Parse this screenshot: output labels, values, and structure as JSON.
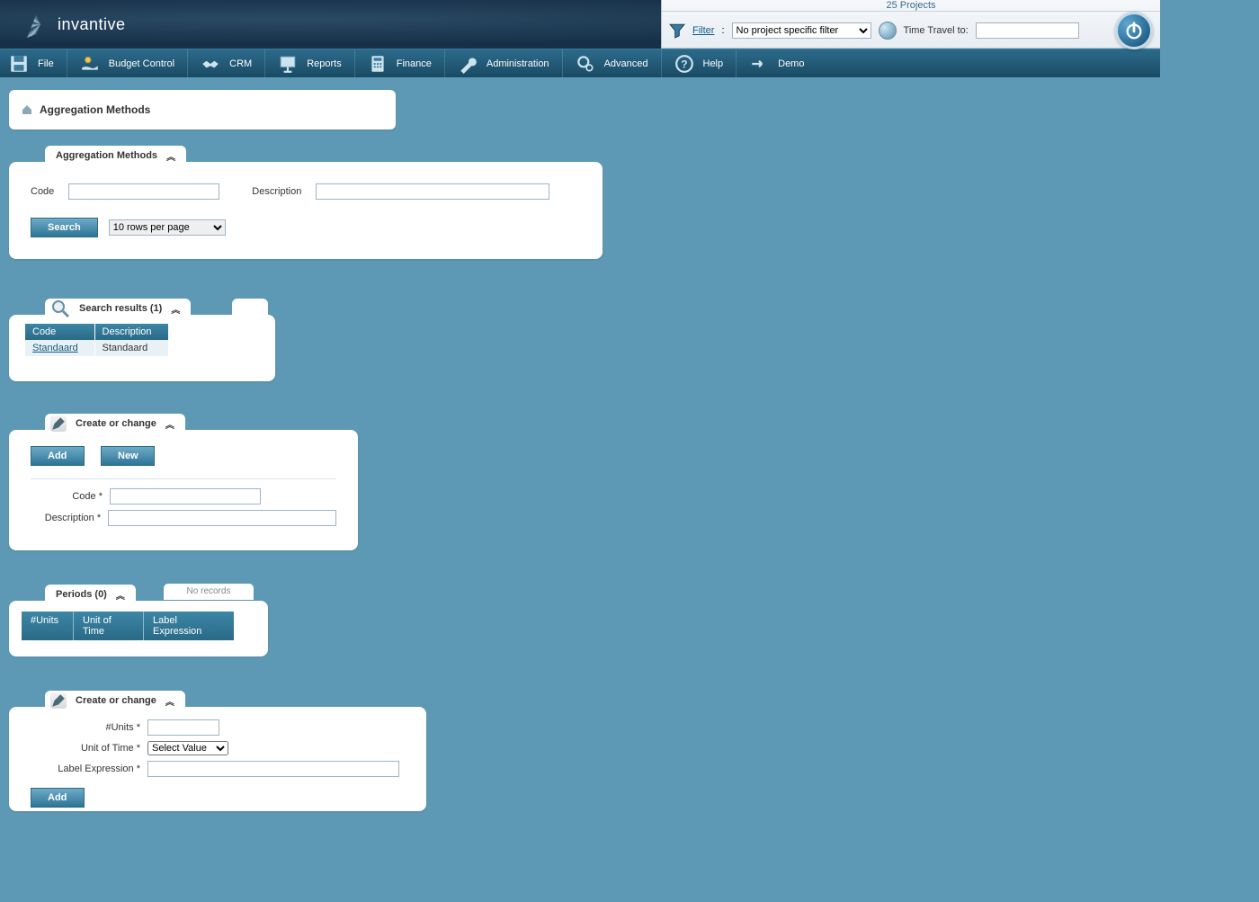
{
  "brand": "invantive",
  "header": {
    "projects": "25 Projects",
    "filter_label": "Filter",
    "filter_colon": ":",
    "filter_selected": "No project specific filter",
    "time_travel_label": "Time Travel to:",
    "time_travel_value": ""
  },
  "menu": {
    "items": [
      {
        "label": "File"
      },
      {
        "label": "Budget Control"
      },
      {
        "label": "CRM"
      },
      {
        "label": "Reports"
      },
      {
        "label": "Finance"
      },
      {
        "label": "Administration"
      },
      {
        "label": "Advanced"
      },
      {
        "label": "Help"
      },
      {
        "label": "Demo"
      }
    ]
  },
  "breadcrumb": {
    "title": "Aggregation Methods"
  },
  "search_panel": {
    "tab": "Aggregation Methods",
    "code_label": "Code",
    "code_value": "",
    "desc_label": "Description",
    "desc_value": "",
    "search_btn": "Search",
    "rows_selected": "10 rows per page"
  },
  "results_panel": {
    "tab": "Search results (1)",
    "columns": [
      "Code",
      "Description"
    ],
    "rows": [
      {
        "code": "Standaard",
        "desc": "Standaard"
      }
    ]
  },
  "cc1": {
    "tab": "Create or change",
    "add_btn": "Add",
    "new_btn": "New",
    "code_label": "Code *",
    "code_value": "",
    "desc_label": "Description *",
    "desc_value": ""
  },
  "periods": {
    "tab": "Periods (0)",
    "no_records": "No records",
    "columns": [
      "#Units",
      "Unit of Time",
      "Label Expression"
    ]
  },
  "cc2": {
    "tab": "Create or change",
    "units_label": "#Units *",
    "units_value": "",
    "uot_label": "Unit of Time *",
    "uot_selected": "Select Value",
    "lblexp_label": "Label Expression *",
    "lblexp_value": "",
    "add_btn": "Add"
  }
}
